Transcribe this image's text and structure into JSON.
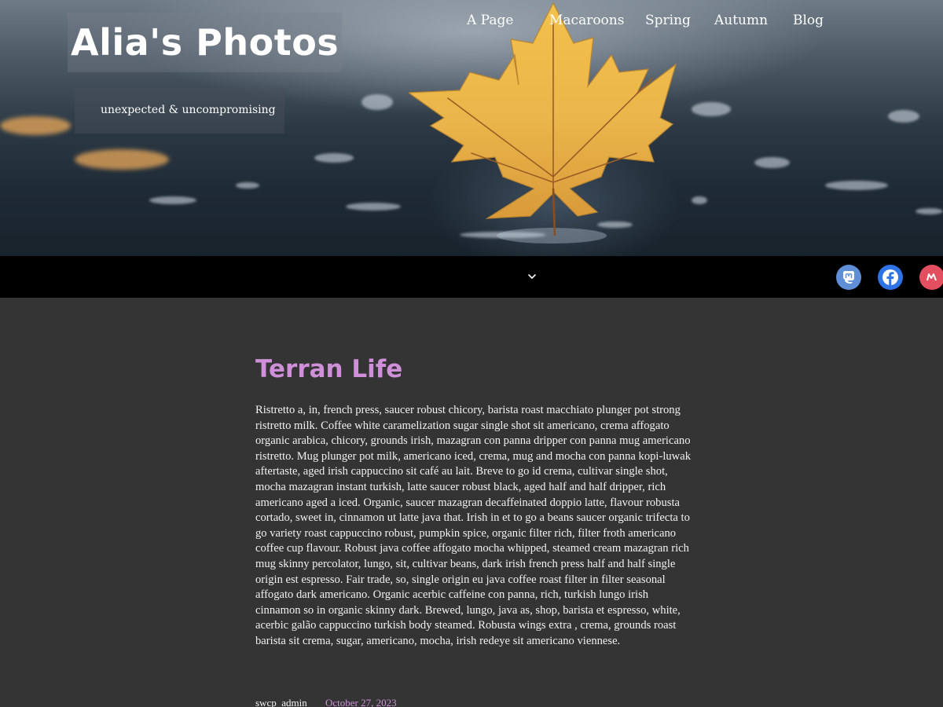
{
  "header": {
    "site_title": "Alia's Photos",
    "tagline": "unexpected & uncompromising"
  },
  "nav": {
    "items": [
      {
        "label": "A Page",
        "has_submenu": true
      },
      {
        "label": "Macaroons"
      },
      {
        "label": "Spring"
      },
      {
        "label": "Autumn"
      },
      {
        "label": "Blog"
      }
    ],
    "social": [
      {
        "icon": "mastodon-icon",
        "color": "#5f8fd6"
      },
      {
        "icon": "facebook-icon",
        "color": "#2f74e6"
      },
      {
        "icon": "meetup-icon",
        "color": "#e34f5e"
      }
    ]
  },
  "post": {
    "title": "Terran Life",
    "body": "Ristretto a, in, french press, saucer robust chicory, barista roast macchiato plunger pot strong ristretto milk. Coffee white caramelization sugar single shot sit americano, crema affogato organic arabica, chicory, grounds irish, mazagran con panna dripper con panna mug americano ristretto. Mug plunger pot milk, americano iced, crema, mug and mocha con panna kopi-luwak aftertaste, aged irish cappuccino sit café au lait. Breve to go id crema, cultivar single shot, mocha mazagran instant turkish, latte saucer robust black, aged half and half dripper, rich americano aged a iced. Organic, saucer mazagran decaffeinated doppio latte, flavour robusta cortado, sweet in, cinnamon ut latte java that. Irish in et to go a beans saucer organic trifecta to go variety roast cappuccino robust, pumpkin spice, organic filter rich, filter froth americano coffee cup flavour. Robust java coffee affogato mocha whipped, steamed cream mazagran rich mug skinny percolator, lungo, sit, cultivar beans, dark irish french press half and half single origin est espresso. Fair trade, so, single origin eu java coffee roast filter in filter seasonal affogato dark americano. Organic acerbic caffeine con panna, rich, turkish lungo irish cinnamon so in organic skinny dark. Brewed, lungo, java as, shop, barista et espresso, white, acerbic galão cappuccino turkish body steamed. Robusta wings extra , crema, grounds roast barista sit crema, sugar, americano, mocha, irish redeye sit americano viennese.",
    "author": "swcp_admin",
    "date": "October 27, 2023"
  },
  "colors": {
    "accent": "#cf8fd9",
    "background": "#343434",
    "nav_background": "#000000",
    "text": "#f1f1f1"
  }
}
